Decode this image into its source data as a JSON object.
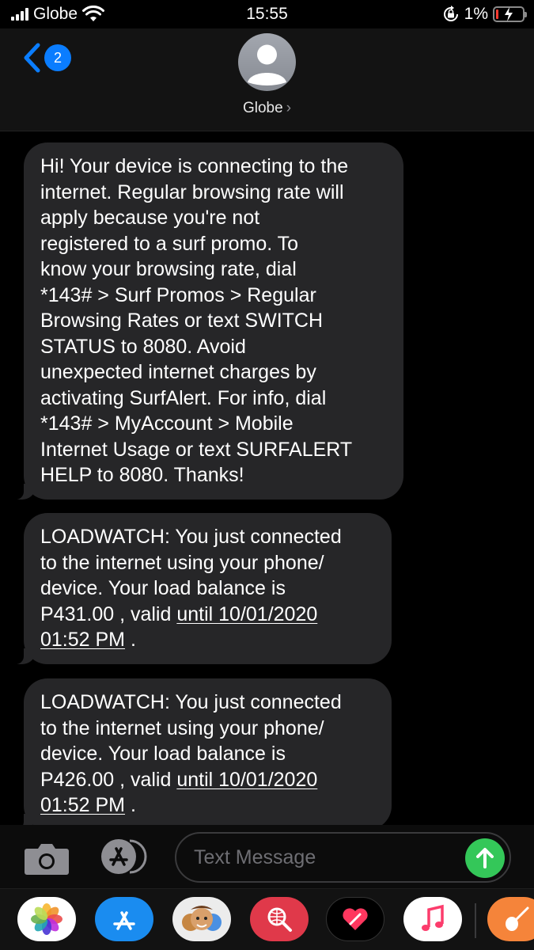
{
  "status_bar": {
    "carrier": "Globe",
    "time": "15:55",
    "battery": "1%",
    "battery_level": 0.01
  },
  "header": {
    "back_badge_count": "2",
    "contact_name": "Globe",
    "contact_chevron": "›"
  },
  "messages": [
    {
      "segments": [
        {
          "text": "Hi! Your device is connecting to the\ninternet. Regular browsing rate will\napply because you're not\nregistered to a surf promo. To\nknow your browsing rate, dial\n*143# > Surf Promos > Regular\nBrowsing Rates or text SWITCH\nSTATUS to 8080. Avoid\nunexpected internet charges by\nactivating SurfAlert. For info, dial\n*143# > MyAccount > Mobile\nInternet Usage or text SURFALERT\nHELP to 8080. Thanks!"
        }
      ]
    },
    {
      "segments": [
        {
          "text": "LOADWATCH: You just connected\nto the internet using your phone/\ndevice. Your load balance is\nP431.00 , valid "
        },
        {
          "text": "until 10/01/2020\n01:52 PM",
          "link": true
        },
        {
          "text": " ."
        }
      ]
    },
    {
      "segments": [
        {
          "text": "LOADWATCH: You just connected\nto the internet using your phone/\ndevice. Your load balance is\nP426.00 , valid "
        },
        {
          "text": "until 10/01/2020\n01:52 PM",
          "link": true
        },
        {
          "text": " ."
        }
      ]
    }
  ],
  "input_bar": {
    "placeholder": "Text Message"
  },
  "app_drawer": {
    "apps": [
      "photos-icon",
      "app-store-icon",
      "memoji-icon",
      "search-web-icon",
      "digital-touch-icon",
      "music-icon",
      "garageband-icon"
    ]
  },
  "colors": {
    "bubble": "#262628",
    "accent_blue": "#0a7dff",
    "send_green": "#34c759",
    "battery_red": "#ff3b30"
  }
}
